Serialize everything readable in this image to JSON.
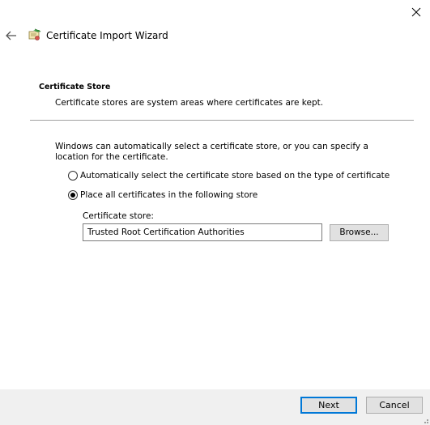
{
  "window": {
    "close_glyph": "✕"
  },
  "header": {
    "title": "Certificate Import Wizard",
    "back_icon": "back-arrow-icon",
    "app_icon": "certificate-wizard-icon"
  },
  "page": {
    "heading": "Certificate Store",
    "description": "Certificate stores are system areas where certificates are kept.",
    "intro": "Windows can automatically select a certificate store, or you can specify a location for the certificate."
  },
  "options": [
    {
      "label": "Automatically select the certificate store based on the type of certificate",
      "selected": false
    },
    {
      "label": "Place all certificates in the following store",
      "selected": true
    }
  ],
  "store": {
    "label": "Certificate store:",
    "value": "Trusted Root Certification Authorities",
    "browse_label": "Browse..."
  },
  "footer": {
    "next_label": "Next",
    "cancel_label": "Cancel"
  },
  "colors": {
    "accent": "#0078d7",
    "footer_bg": "#f0f0f0",
    "button_bg": "#e1e1e1"
  }
}
